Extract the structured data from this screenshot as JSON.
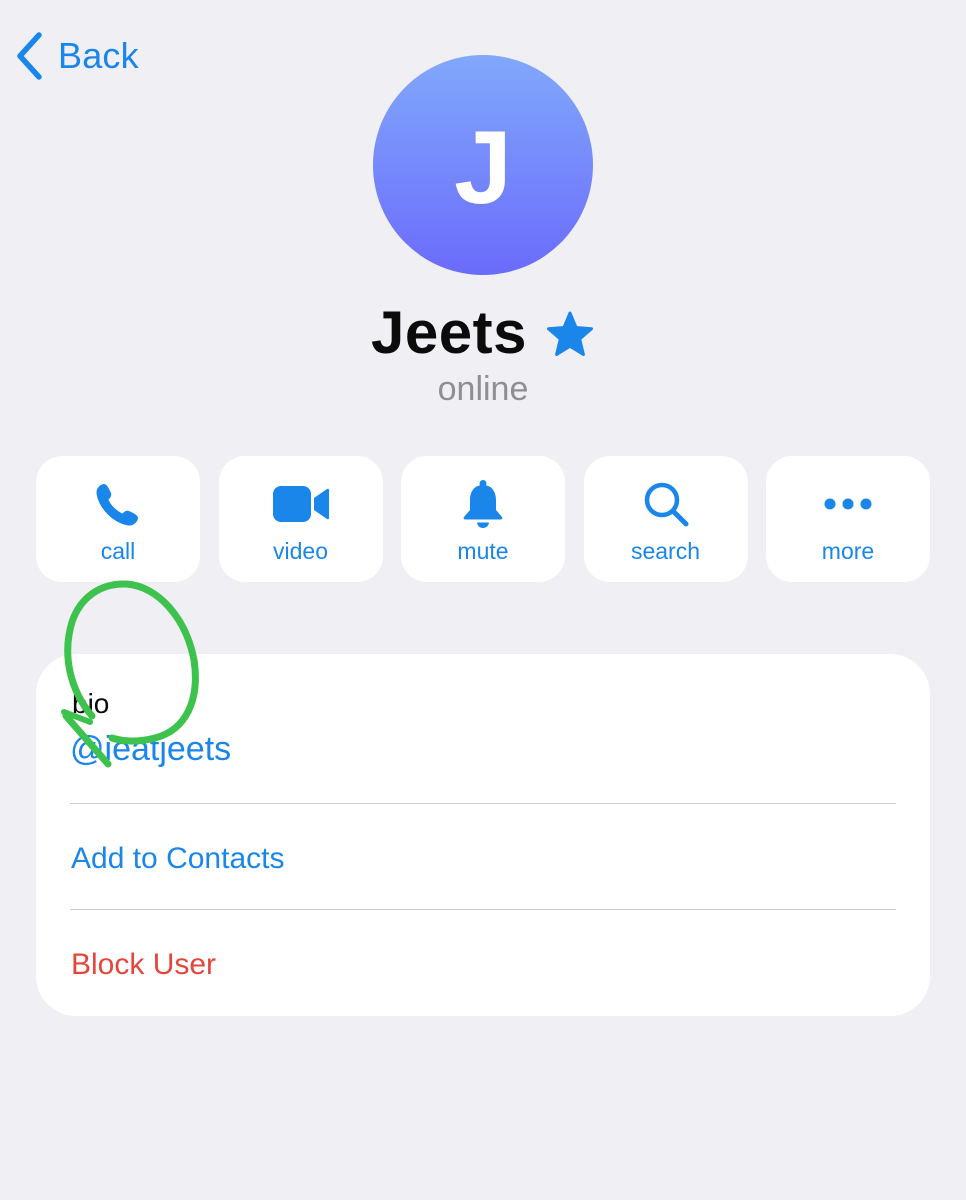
{
  "nav": {
    "back_label": "Back"
  },
  "profile": {
    "avatar_initial": "J",
    "name": "Jeets",
    "status": "online",
    "badge_icon": "star-icon"
  },
  "actions": [
    {
      "label": "call",
      "icon": "phone-icon"
    },
    {
      "label": "video",
      "icon": "video-camera-icon"
    },
    {
      "label": "mute",
      "icon": "bell-icon"
    },
    {
      "label": "search",
      "icon": "search-icon"
    },
    {
      "label": "more",
      "icon": "ellipsis-icon"
    }
  ],
  "info": {
    "bio_label": "bio",
    "username": "@ieatjeets",
    "add_contact_label": "Add to Contacts",
    "block_label": "Block User"
  },
  "colors": {
    "accent": "#1a86ea",
    "destructive": "#e5463c",
    "background": "#efeff4",
    "annotation": "#3dc24e"
  }
}
